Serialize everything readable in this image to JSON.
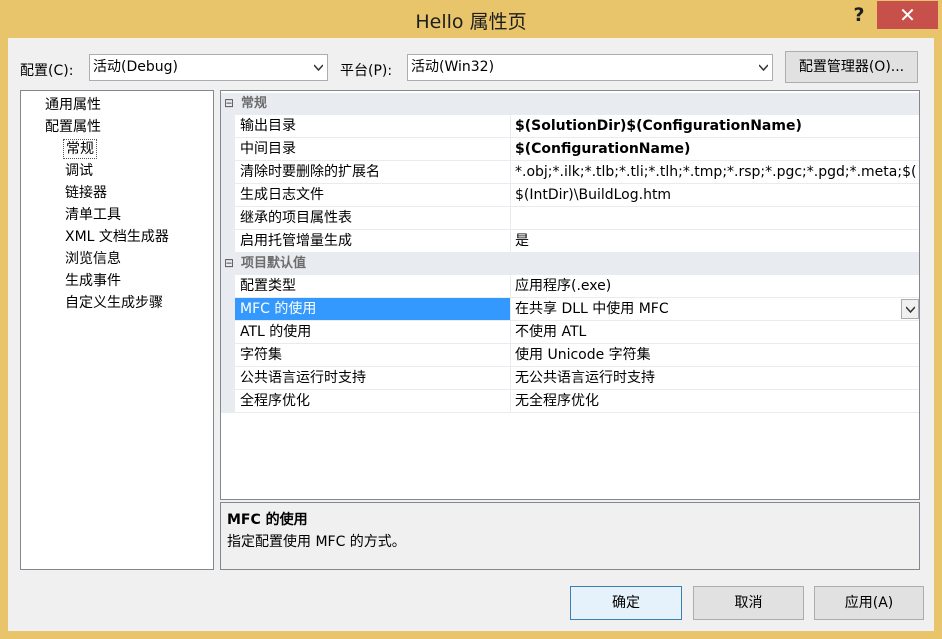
{
  "window": {
    "title": "Hello 属性页",
    "help": "?",
    "close": "✕"
  },
  "toolbar": {
    "config_label": "配置(C):",
    "config_value": "活动(Debug)",
    "platform_label": "平台(P):",
    "platform_value": "活动(Win32)",
    "config_manager": "配置管理器(O)..."
  },
  "tree": {
    "items": [
      {
        "label": "通用属性"
      },
      {
        "label": "配置属性"
      },
      {
        "label": "常规"
      },
      {
        "label": "调试"
      },
      {
        "label": "链接器"
      },
      {
        "label": "清单工具"
      },
      {
        "label": "XML 文档生成器"
      },
      {
        "label": "浏览信息"
      },
      {
        "label": "生成事件"
      },
      {
        "label": "自定义生成步骤"
      }
    ]
  },
  "grid": {
    "categories": [
      {
        "label": "常规",
        "toggle": "⊟"
      },
      {
        "label": "项目默认值",
        "toggle": "⊟"
      }
    ],
    "general": [
      {
        "name": "输出目录",
        "value": "$(SolutionDir)$(ConfigurationName)"
      },
      {
        "name": "中间目录",
        "value": "$(ConfigurationName)"
      },
      {
        "name": "清除时要删除的扩展名",
        "value": "*.obj;*.ilk;*.tlb;*.tli;*.tlh;*.tmp;*.rsp;*.pgc;*.pgd;*.meta;$("
      },
      {
        "name": "生成日志文件",
        "value": "$(IntDir)\\BuildLog.htm"
      },
      {
        "name": "继承的项目属性表",
        "value": ""
      },
      {
        "name": "启用托管增量生成",
        "value": "是"
      }
    ],
    "defaults": [
      {
        "name": "配置类型",
        "value": "应用程序(.exe)"
      },
      {
        "name": "MFC 的使用",
        "value": "在共享 DLL 中使用 MFC"
      },
      {
        "name": "ATL 的使用",
        "value": "不使用 ATL"
      },
      {
        "name": "字符集",
        "value": "使用 Unicode 字符集"
      },
      {
        "name": "公共语言运行时支持",
        "value": "无公共语言运行时支持"
      },
      {
        "name": "全程序优化",
        "value": "无全程序优化"
      }
    ]
  },
  "description": {
    "title": "MFC 的使用",
    "text": "指定配置使用 MFC 的方式。"
  },
  "buttons": {
    "ok": "确定",
    "cancel": "取消",
    "apply": "应用(A)"
  },
  "colors": {
    "titlebar": "#e8c46b",
    "close": "#c7504b",
    "selection": "#3399ff"
  },
  "icons": {
    "combo_arrow": "chevron-down-icon",
    "expand": "collapse-icon"
  }
}
